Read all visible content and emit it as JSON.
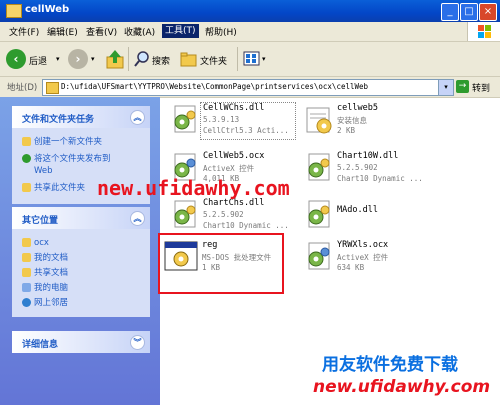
{
  "window": {
    "title": "cellWeb"
  },
  "menu": [
    "文件(F)",
    "编辑(E)",
    "查看(V)",
    "收藏(A)",
    "工具(T)",
    "帮助(H)"
  ],
  "menu_selected_index": 4,
  "toolbar": {
    "back": "后退",
    "search": "搜索",
    "folders": "文件夹"
  },
  "address": {
    "label": "地址(D)",
    "path": "D:\\ufida\\UFSmart\\YYTPRO\\Website\\CommonPage\\printservices\\ocx\\cellWeb",
    "go": "转到"
  },
  "panels": {
    "tasks": {
      "title": "文件和文件夹任务",
      "items": [
        "创建一个新文件夹",
        "将这个文件夹发布到",
        "Web",
        "共享此文件夹"
      ]
    },
    "places": {
      "title": "其它位置",
      "items": [
        "ocx",
        "我的文档",
        "共享文档",
        "我的电脑",
        "网上邻居"
      ]
    },
    "details": {
      "title": "详细信息"
    }
  },
  "files": [
    {
      "name": "CellWChs.dll",
      "line1": "5.3.9.13",
      "line2": "CellCtrl5.3 Acti..."
    },
    {
      "name": "cellweb5",
      "line1": "安装信息",
      "line2": "2 KB"
    },
    {
      "name": "CellWeb5.ocx",
      "line1": "ActiveX 控件",
      "line2": "4,011 KB"
    },
    {
      "name": "Chart10W.dll",
      "line1": "5.2.5.902",
      "line2": "Chart10 Dynamic ..."
    },
    {
      "name": "ChartChs.dll",
      "line1": "5.2.5.902",
      "line2": "Chart10 Dynamic ..."
    },
    {
      "name": "MAdo.dll",
      "line1": "",
      "line2": ""
    },
    {
      "name": "reg",
      "line1": "MS-DOS 批处理文件",
      "line2": "1 KB"
    },
    {
      "name": "YRWXls.ocx",
      "line1": "ActiveX 控件",
      "line2": "634 KB"
    }
  ],
  "watermarks": {
    "main": "new.ufidawhy.com",
    "bottom_cn": "用友软件免费下载",
    "bottom_url": "new.ufidawhy.com"
  },
  "colors": {
    "titlebar": "#0346c7",
    "link": "#215dc6",
    "highlight": "#e8141f"
  }
}
